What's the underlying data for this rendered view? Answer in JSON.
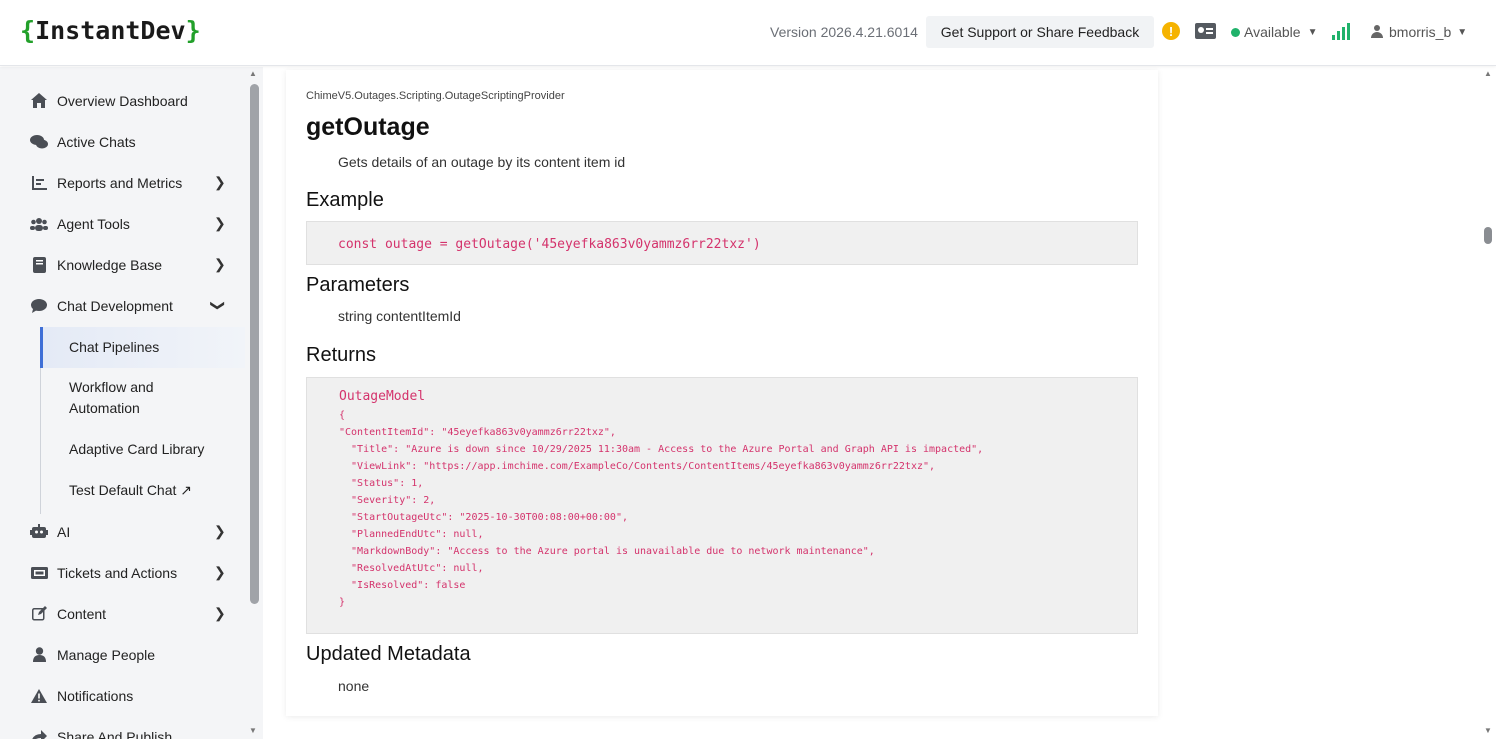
{
  "header": {
    "logo_open": "{",
    "logo_text": "InstantDev",
    "logo_close": "}",
    "version": "Version 2026.4.21.6014",
    "support_label": "Get Support or Share Feedback",
    "alert_glyph": "!",
    "status_label": "Available",
    "username": "bmorris_b",
    "accent_green": "#20b26b"
  },
  "sidebar": {
    "items": [
      {
        "label": "Overview Dashboard",
        "icon": "home-icon"
      },
      {
        "label": "Active Chats",
        "icon": "chats-icon"
      },
      {
        "label": "Reports and Metrics",
        "icon": "chart-icon"
      },
      {
        "label": "Agent Tools",
        "icon": "users-icon"
      },
      {
        "label": "Knowledge Base",
        "icon": "book-icon"
      },
      {
        "label": "Chat Development",
        "icon": "chat-bubble-icon"
      },
      {
        "label": "AI",
        "icon": "robot-icon"
      },
      {
        "label": "Tickets and Actions",
        "icon": "ticket-icon"
      },
      {
        "label": "Content",
        "icon": "edit-icon"
      },
      {
        "label": "Manage People",
        "icon": "person-icon"
      },
      {
        "label": "Notifications",
        "icon": "warning-icon"
      },
      {
        "label": "Share And Publish",
        "icon": "share-icon"
      }
    ],
    "sub_items": [
      {
        "label": "Chat Pipelines"
      },
      {
        "label": "Workflow and Automation"
      },
      {
        "label": "Adaptive Card Library"
      },
      {
        "label": "Test Default Chat ↗"
      }
    ]
  },
  "doc": {
    "namespace": "ChimeV5.Outages.Scripting.OutageScriptingProvider",
    "title": "getOutage",
    "description": "Gets details of an outage by its content item id",
    "example_heading": "Example",
    "example_code": "const outage = getOutage('45eyefka863v0yammz6rr22txz')",
    "parameters_heading": "Parameters",
    "parameters_text": "string contentItemId",
    "returns_heading": "Returns",
    "returns_model": "OutageModel",
    "returns_json": "{\n\"ContentItemId\": \"45eyefka863v0yammz6rr22txz\",\n  \"Title\": \"Azure is down since 10/29/2025 11:30am - Access to the Azure Portal and Graph API is impacted\",\n  \"ViewLink\": \"https://app.imchime.com/ExampleCo/Contents/ContentItems/45eyefka863v0yammz6rr22txz\",\n  \"Status\": 1,\n  \"Severity\": 2,\n  \"StartOutageUtc\": \"2025-10-30T00:08:00+00:00\",\n  \"PlannedEndUtc\": null,\n  \"MarkdownBody\": \"Access to the Azure portal is unavailable due to network maintenance\",\n  \"ResolvedAtUtc\": null,\n  \"IsResolved\": false\n}",
    "metadata_heading": "Updated Metadata",
    "metadata_text": "none"
  }
}
